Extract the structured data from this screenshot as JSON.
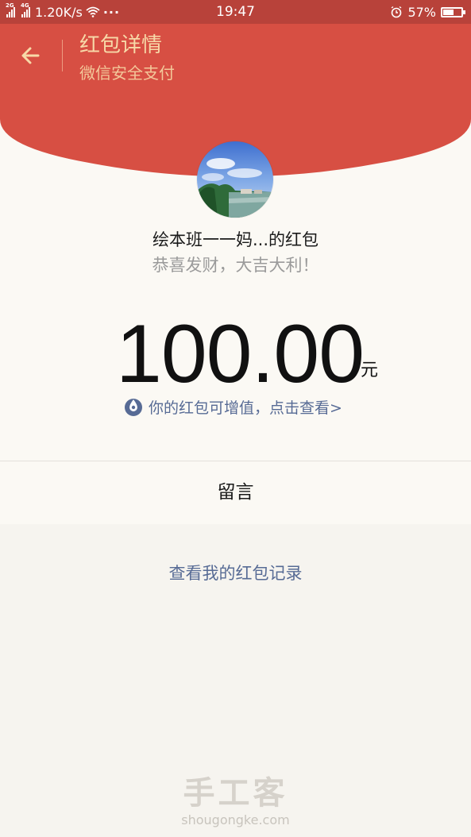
{
  "status_bar": {
    "network1": "2G",
    "network2": "4G",
    "speed": "1.20K/s",
    "more": "···",
    "time": "19:47",
    "battery_percent": "57%",
    "battery_level": 0.57
  },
  "header": {
    "title": "红包详情",
    "subtitle": "微信安全支付"
  },
  "red_packet": {
    "sender": "绘本班一一妈...的红包",
    "greeting": "恭喜发财，大吉大利！",
    "amount": "100.00",
    "unit": "元",
    "invest_link": "你的红包可增值，点击查看>"
  },
  "message": {
    "label": "留言"
  },
  "footer": {
    "records_link": "查看我的红包记录"
  },
  "watermark": {
    "logo_text": "手工客",
    "url": "shougongke.com"
  },
  "colors": {
    "header_red": "#d74f43",
    "status_bar": "#b8423a",
    "title_gold": "#f7d9a8",
    "link_blue": "#576b95"
  },
  "icons": {
    "back": "arrow-left-icon",
    "invest": "coin-drop-icon",
    "wifi": "wifi-icon",
    "alarm": "alarm-icon",
    "battery": "battery-icon"
  }
}
